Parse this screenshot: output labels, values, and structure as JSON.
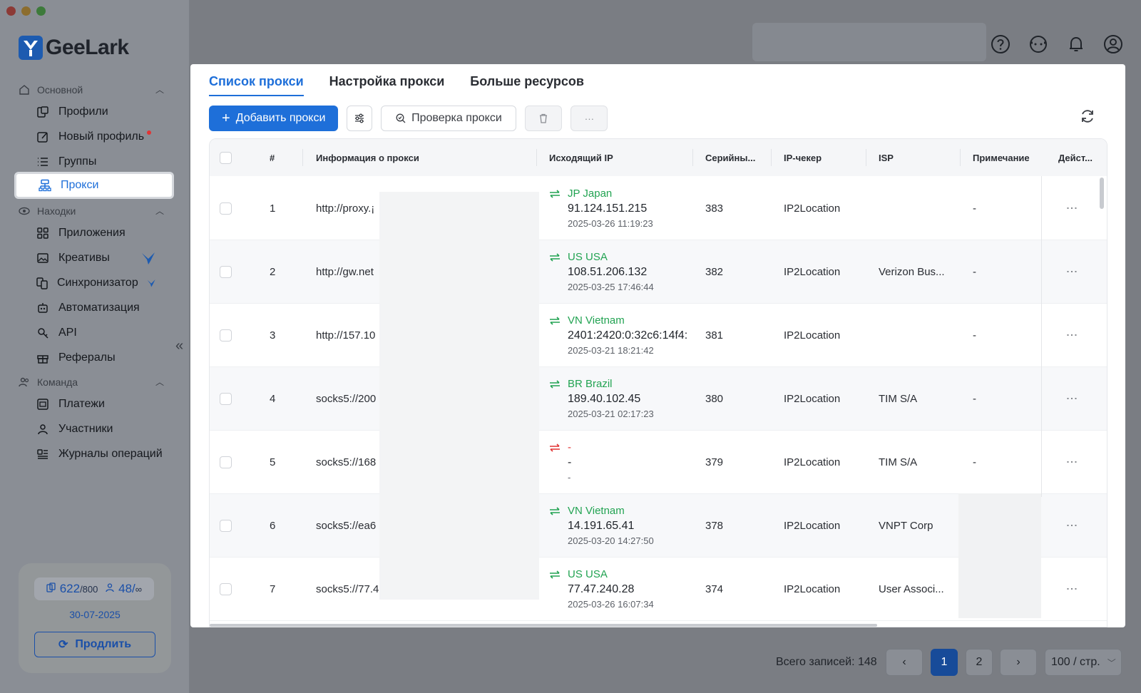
{
  "app": {
    "brand": "GeeLark"
  },
  "sidebar": {
    "sections": [
      {
        "label": "Основной",
        "icon": "home-icon"
      },
      {
        "label": "Находки",
        "icon": "eye-icon"
      },
      {
        "label": "Команда",
        "icon": "team-icon"
      }
    ],
    "items": [
      {
        "label": "Профили",
        "icon": "profiles-icon"
      },
      {
        "label": "Новый профиль",
        "icon": "edit-icon"
      },
      {
        "label": "Группы",
        "icon": "list-icon"
      },
      {
        "label": "Прокси",
        "icon": "proxy-icon"
      },
      {
        "label": "Приложения",
        "icon": "apps-icon"
      },
      {
        "label": "Креативы",
        "icon": "image-icon"
      },
      {
        "label": "Синхронизатор",
        "icon": "sync-icon"
      },
      {
        "label": "Автоматизация",
        "icon": "robot-icon"
      },
      {
        "label": "API",
        "icon": "api-icon"
      },
      {
        "label": "Рефералы",
        "icon": "gift-icon"
      },
      {
        "label": "Платежи",
        "icon": "payment-icon"
      },
      {
        "label": "Участники",
        "icon": "user-icon"
      },
      {
        "label": "Журналы операций",
        "icon": "log-icon"
      }
    ],
    "account": {
      "profiles_used": "622",
      "profiles_total": "/800",
      "members": "48/",
      "members_limit": "∞",
      "expiry": "30-07-2025",
      "renew_label": "Продлить"
    }
  },
  "modal": {
    "tabs": [
      "Список прокси",
      "Настройка прокси",
      "Больше ресурсов"
    ],
    "toolbar": {
      "add_label": "Добавить прокси",
      "check_label": "Проверка прокси",
      "more_label": "···"
    },
    "columns": [
      "#",
      "Информация о прокси",
      "Исходящий IP",
      "Серийны...",
      "IP-чекер",
      "ISP",
      "Примечание",
      "Дейст..."
    ],
    "rows": [
      {
        "n": "1",
        "proxy": "http://proxy.¡",
        "flag": "JP Japan",
        "ip": "91.124.151.215",
        "time": "2025-03-26 11:19:23",
        "serial": "383",
        "checker": "IP2Location",
        "isp": "",
        "note": "-",
        "ok": true
      },
      {
        "n": "2",
        "proxy": "http://gw.net",
        "flag": "US USA",
        "ip": "108.51.206.132",
        "time": "2025-03-25 17:46:44",
        "serial": "382",
        "checker": "IP2Location",
        "isp": "Verizon Bus...",
        "note": "-",
        "ok": true
      },
      {
        "n": "3",
        "proxy": "http://157.10",
        "flag": "VN Vietnam",
        "ip": "2401:2420:0:32c6:14f4:",
        "time": "2025-03-21 18:21:42",
        "serial": "381",
        "checker": "IP2Location",
        "isp": "",
        "note": "-",
        "ok": true
      },
      {
        "n": "4",
        "proxy": "socks5://200",
        "flag": "BR Brazil",
        "ip": "189.40.102.45",
        "time": "2025-03-21 02:17:23",
        "serial": "380",
        "checker": "IP2Location",
        "isp": "TIM S/A",
        "note": "-",
        "ok": true
      },
      {
        "n": "5",
        "proxy": "socks5://168",
        "flag": "-",
        "ip": "-",
        "time": "-",
        "serial": "379",
        "checker": "IP2Location",
        "isp": "TIM S/A",
        "note": "-",
        "ok": false
      },
      {
        "n": "6",
        "proxy": "socks5://ea6",
        "flag": "VN Vietnam",
        "ip": "14.191.65.41",
        "time": "2025-03-20 14:27:50",
        "serial": "378",
        "checker": "IP2Location",
        "isp": "VNPT Corp",
        "note": "",
        "ok": true
      },
      {
        "n": "7",
        "proxy": "socks5://77.4",
        "flag": "US USA",
        "ip": "77.47.240.28",
        "time": "2025-03-26 16:07:34",
        "serial": "374",
        "checker": "IP2Location",
        "isp": "User Associ...",
        "note": "",
        "ok": true
      }
    ]
  },
  "pagination": {
    "total_label": "Всего записей: 148",
    "pages": [
      "1",
      "2"
    ],
    "prev": "‹",
    "next": "›",
    "size_label": "100 / стр."
  },
  "colors": {
    "accent": "#1e6fd9",
    "ok": "#22a352",
    "error": "#e23434"
  }
}
